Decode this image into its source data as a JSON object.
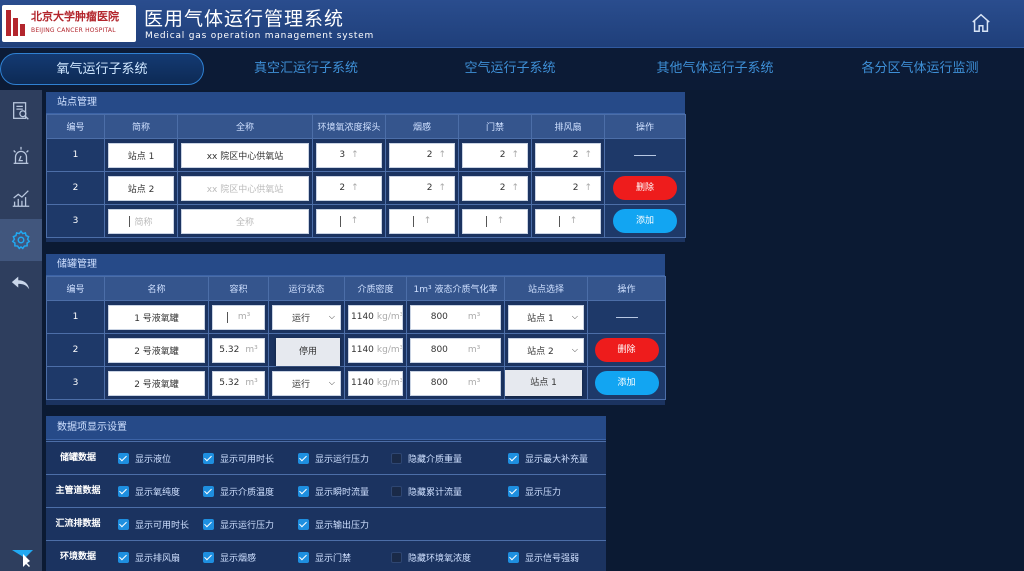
{
  "header": {
    "logo_cn": "北京大学肿瘤医院",
    "logo_en": "BEIJING CANCER HOSPITAL",
    "title": "医用气体运行管理系统",
    "subtitle": "Medical gas operation management system",
    "home_icon": "home-icon"
  },
  "nav": {
    "tabs": [
      {
        "label": "氧气运行子系统",
        "active": true
      },
      {
        "label": "真空汇运行子系统"
      },
      {
        "label": "空气运行子系统"
      },
      {
        "label": "其他气体运行子系统"
      },
      {
        "label": "各分区气体运行监测"
      }
    ]
  },
  "sidebar": {
    "items": [
      "report-search-icon",
      "alarm-icon",
      "trend-chart-icon",
      "settings-icon",
      "back-arrow-icon"
    ],
    "active": "settings-icon"
  },
  "stations": {
    "title": "站点管理",
    "columns": [
      "编号",
      "简称",
      "全称",
      "环境氧浓度探头",
      "烟感",
      "门禁",
      "排风扇",
      "操作"
    ],
    "rows": [
      {
        "no": "1",
        "short": "站点 1",
        "full": "xx 院区中心供氧站",
        "o2": "3",
        "smoke": "2",
        "door": "2",
        "fan": "2"
      },
      {
        "no": "2",
        "short": "站点 2",
        "full": "xx 院区中心供氧站",
        "o2": "2",
        "smoke": "2",
        "door": "2",
        "fan": "2",
        "action": "删除"
      },
      {
        "no": "3",
        "short_ph": "简称",
        "full_ph": "全称",
        "action": "添加"
      }
    ]
  },
  "tanks": {
    "title": "储罐管理",
    "columns": [
      "编号",
      "名称",
      "容积",
      "运行状态",
      "介质密度",
      "1m³ 液态介质气化率",
      "站点选择",
      "操作"
    ],
    "rows": [
      {
        "no": "1",
        "name": "1 号液氧罐",
        "volume_unit": "m³",
        "status": "运行",
        "density": "1140",
        "density_unit": "kg/m³",
        "rate": "800",
        "rate_unit": "m³",
        "station": "站点 1"
      },
      {
        "no": "2",
        "name": "2 号液氧罐",
        "volume": "5.32",
        "volume_unit": "m³",
        "density": "1140",
        "density_unit": "kg/m³",
        "rate": "800",
        "rate_unit": "m³",
        "station": "站点 2",
        "action": "删除"
      },
      {
        "no": "3",
        "name": "2 号液氧罐",
        "volume": "5.32",
        "volume_unit": "m³",
        "status": "运行",
        "density": "1140",
        "density_unit": "kg/m³",
        "rate": "800",
        "rate_unit": "m³",
        "action": "添加"
      }
    ],
    "status_dropdown": "停用",
    "station_dropdown": "站点 1"
  },
  "display": {
    "title": "数据项显示设置",
    "rows": [
      {
        "label": "储罐数据",
        "items": [
          {
            "text": "显示液位",
            "checked": true
          },
          {
            "text": "显示可用时长",
            "checked": true
          },
          {
            "text": "显示运行压力",
            "checked": true
          },
          {
            "text": "隐藏介质重量",
            "checked": false
          },
          {
            "text": "显示最大补充量",
            "checked": true
          }
        ]
      },
      {
        "label": "主管道数据",
        "items": [
          {
            "text": "显示氧纯度",
            "checked": true
          },
          {
            "text": "显示介质温度",
            "checked": true
          },
          {
            "text": "显示瞬时流量",
            "checked": true
          },
          {
            "text": "隐藏累计流量",
            "checked": false
          },
          {
            "text": "显示压力",
            "checked": true
          }
        ]
      },
      {
        "label": "汇流排数据",
        "items": [
          {
            "text": "显示可用时长",
            "checked": true
          },
          {
            "text": "显示运行压力",
            "checked": true
          },
          {
            "text": "显示输出压力",
            "checked": true
          }
        ]
      },
      {
        "label": "环境数据",
        "items": [
          {
            "text": "显示排风扇",
            "checked": true
          },
          {
            "text": "显示烟感",
            "checked": true
          },
          {
            "text": "显示门禁",
            "checked": true
          },
          {
            "text": "隐藏环境氧浓度",
            "checked": false
          },
          {
            "text": "显示信号强弱",
            "checked": true
          }
        ]
      }
    ]
  },
  "colors": {
    "bg": "#0b1a33",
    "header": "#2a4d8e",
    "delete": "#ee1c1c",
    "add": "#12a5f2",
    "accent": "#3e8fd6"
  }
}
